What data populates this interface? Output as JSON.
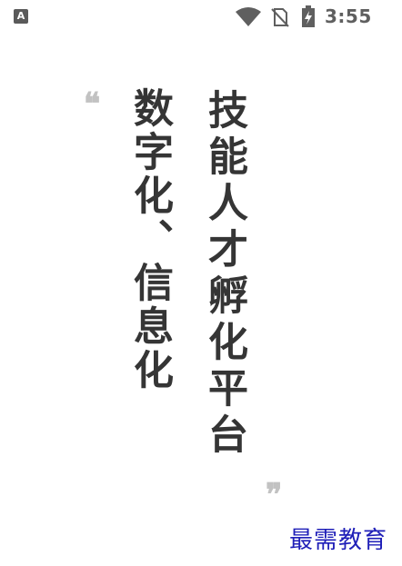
{
  "status_bar": {
    "notification_icon": "app-notification-icon",
    "notification_letter": "A",
    "wifi_icon": "wifi-icon",
    "sim_icon": "no-sim-icon",
    "battery_icon": "battery-charging-icon",
    "time": "3:55"
  },
  "splash": {
    "title_line_1": "技能人才孵化平台",
    "title_line_2": "数字化、信息化",
    "quote_open": "❝",
    "quote_close": "❞"
  },
  "watermark": {
    "text": "最需教育",
    "color": "#1f1fb8"
  },
  "colors": {
    "background": "#ffffff",
    "title_text": "#353535",
    "quote_marks": "#c2c2c2",
    "status_icons": "#5f5f5f"
  }
}
